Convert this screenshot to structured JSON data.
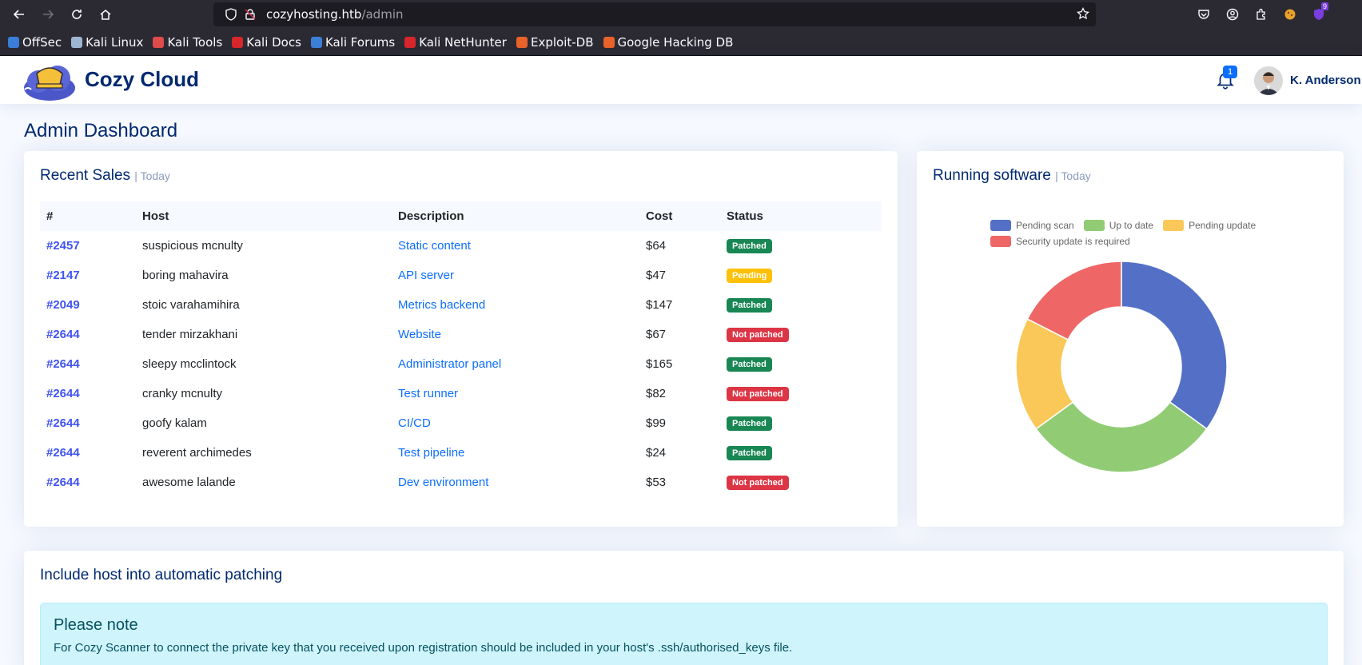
{
  "browser": {
    "url_host": "cozyhosting.htb",
    "url_path": "/admin",
    "extension_badge": "9"
  },
  "bookmarks": [
    {
      "label": "OffSec",
      "color": "#3b7dd8"
    },
    {
      "label": "Kali Linux",
      "color": "#9fb6d3"
    },
    {
      "label": "Kali Tools",
      "color": "#e04b4b"
    },
    {
      "label": "Kali Docs",
      "color": "#d7262c"
    },
    {
      "label": "Kali Forums",
      "color": "#3c7fd8"
    },
    {
      "label": "Kali NetHunter",
      "color": "#d7262c"
    },
    {
      "label": "Exploit-DB",
      "color": "#e8622a"
    },
    {
      "label": "Google Hacking DB",
      "color": "#e8622a"
    }
  ],
  "header": {
    "brand": "Cozy Cloud",
    "notification_count": "1",
    "user_name": "K. Anderson"
  },
  "page_title": "Admin Dashboard",
  "sales": {
    "title": "Recent Sales",
    "subtitle": "| Today",
    "columns": [
      "#",
      "Host",
      "Description",
      "Cost",
      "Status"
    ],
    "rows": [
      {
        "id": "#2457",
        "host": "suspicious mcnulty",
        "desc": "Static content",
        "cost": "$64",
        "status": "Patched"
      },
      {
        "id": "#2147",
        "host": "boring mahavira",
        "desc": "API server",
        "cost": "$47",
        "status": "Pending"
      },
      {
        "id": "#2049",
        "host": "stoic varahamihira",
        "desc": "Metrics backend",
        "cost": "$147",
        "status": "Patched"
      },
      {
        "id": "#2644",
        "host": "tender mirzakhani",
        "desc": "Website",
        "cost": "$67",
        "status": "Not patched"
      },
      {
        "id": "#2644",
        "host": "sleepy mcclintock",
        "desc": "Administrator panel",
        "cost": "$165",
        "status": "Patched"
      },
      {
        "id": "#2644",
        "host": "cranky mcnulty",
        "desc": "Test runner",
        "cost": "$82",
        "status": "Not patched"
      },
      {
        "id": "#2644",
        "host": "goofy kalam",
        "desc": "CI/CD",
        "cost": "$99",
        "status": "Patched"
      },
      {
        "id": "#2644",
        "host": "reverent archimedes",
        "desc": "Test pipeline",
        "cost": "$24",
        "status": "Patched"
      },
      {
        "id": "#2644",
        "host": "awesome lalande",
        "desc": "Dev environment",
        "cost": "$53",
        "status": "Not patched"
      }
    ]
  },
  "software": {
    "title": "Running software",
    "subtitle": "| Today"
  },
  "chart_data": {
    "type": "pie",
    "categories": [
      "Pending scan",
      "Up to date",
      "Pending update",
      "Security update is required"
    ],
    "values": [
      35,
      30,
      17.5,
      17.5
    ],
    "colors": [
      "#5470c6",
      "#91cc75",
      "#fac858",
      "#ee6666"
    ],
    "legend": "top",
    "donut": true
  },
  "patching": {
    "title": "Include host into automatic patching",
    "alert_title": "Please note",
    "alert_text": "For Cozy Scanner to connect the private key that you received upon registration should be included in your host's .ssh/authorised_keys file."
  }
}
